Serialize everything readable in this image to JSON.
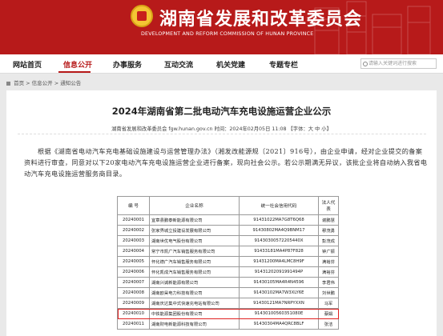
{
  "header": {
    "title": "湖南省发展和改革委员会",
    "subtitle": "DEVELOPMENT AND REFORM COMMISSION OF HUNAN PROVINCE"
  },
  "nav": {
    "items": [
      "网站首页",
      "信息公开",
      "办事服务",
      "互动交流",
      "机关党建",
      "专题专栏"
    ],
    "active": "信息公开",
    "search_placeholder": "请输入关键词进行搜索"
  },
  "breadcrumb": [
    "首页",
    "信息公开",
    "通知公告"
  ],
  "article": {
    "title": "2024年湖南省第二批电动汽车充电设施运营企业公示",
    "meta": "湖南省发展和改革委员会 fgw.hunan.gov.cn    时间：2024年02月05日 11:08  【字体：大 中 小】",
    "paragraph": "根据《湖南省电动汽车充电基础设施建设与运营管理办法》（湘发改能源规〔2021〕916号），由企业申请，经对企业提交的备案资料进行审查，同意对以下20家电动汽车充电设施运营企业进行备案，现向社会公示。若公示期满无异议，该批企业将自动纳入我省电动汽车充电设施运营服务商目录。"
  },
  "table": {
    "headers": [
      "编 号",
      "企业名称",
      "统一社会信用代码",
      "法人代表"
    ],
    "rows": [
      [
        "20240001",
        "宜章县鹏泰新能源有限公司",
        "91431022MA7G8T6Q68",
        "谢鹏慧"
      ],
      [
        "20240002",
        "张家界城立投建设发展有限公司",
        "91430802MA4Q9BNM17",
        "穆茂勇"
      ],
      [
        "20240003",
        "湖南世优电气股份有限公司",
        "91430300572205440X",
        "彭茂成"
      ],
      [
        "20240004",
        "常宁市凯广汽车销售服务有限公司",
        "91433181MA4P87F828",
        "钟广振"
      ],
      [
        "20240005",
        "怀化德广汽车销售服务有限公司",
        "91431200MA4LMC8H9F",
        "满裕芬"
      ],
      [
        "20240006",
        "怀化凯成汽车销售服务有限公司",
        "91431202091991494P",
        "满裕芬"
      ],
      [
        "20240007",
        "湖南兴诚新能源有限公司",
        "91430105MA4R4N4596",
        "李君伟"
      ],
      [
        "20240008",
        "湖南欧昊电力科技有限公司",
        "91430102MA7W3XLY6E",
        "刘世鹏"
      ],
      [
        "20240009",
        "湖南庆达集中式快速充电站有限公司",
        "91430121MA7NRPYXXN",
        "马军"
      ],
      [
        "20240010",
        "中铁能源集团股份有限公司",
        "91430100560351080E",
        "蔡娟"
      ],
      [
        "20240011",
        "湖南财电新能源科技有限公司",
        "91430304MA4QRC8BLF",
        "张洁"
      ]
    ],
    "highlight_row": 9
  }
}
